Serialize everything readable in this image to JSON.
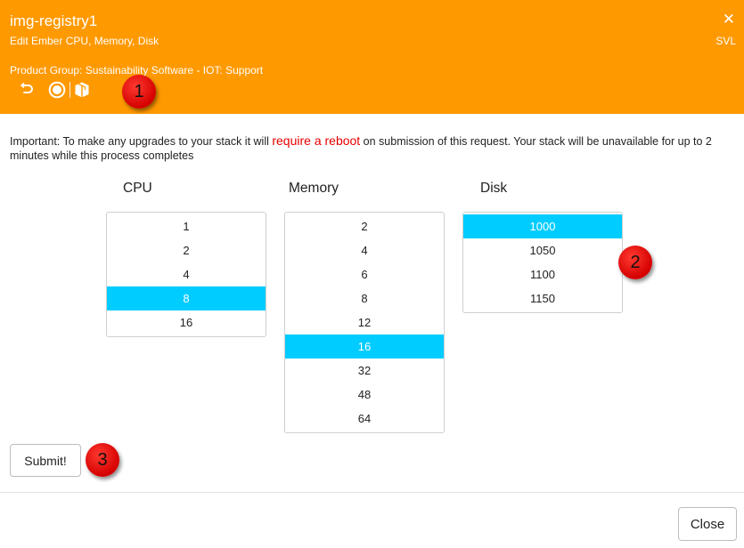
{
  "header": {
    "title": "img-registry1",
    "subtitle": "Edit Ember CPU, Memory, Disk",
    "close_glyph": "✕",
    "site": "SVL",
    "product_group": "Product Group: Sustainability Software - IOT: Support",
    "icons": [
      "undo-icon",
      "record-icon",
      "package-icon"
    ],
    "background": "#ff9900"
  },
  "notice": {
    "before": "Important: To make any upgrades to your stack it will ",
    "highlight": "require a reboot",
    "after": " on submission of this request. Your stack will be unavailable for up to 2 minutes while this process completes"
  },
  "selectors": {
    "cpu": {
      "label": "CPU",
      "options": [
        "1",
        "2",
        "4",
        "8",
        "16"
      ],
      "selected": "8"
    },
    "memory": {
      "label": "Memory",
      "options": [
        "2",
        "4",
        "6",
        "8",
        "12",
        "16",
        "32",
        "48",
        "64"
      ],
      "selected": "16"
    },
    "disk": {
      "label": "Disk",
      "options": [
        "1000",
        "1050",
        "1100",
        "1150"
      ],
      "selected": "1000"
    }
  },
  "badges": [
    "1",
    "2",
    "3"
  ],
  "buttons": {
    "submit": "Submit!",
    "close": "Close"
  },
  "colors": {
    "accent": "#ff9900",
    "selected": "#00ccff",
    "highlight": "#e60000",
    "badge": "#e00000"
  }
}
